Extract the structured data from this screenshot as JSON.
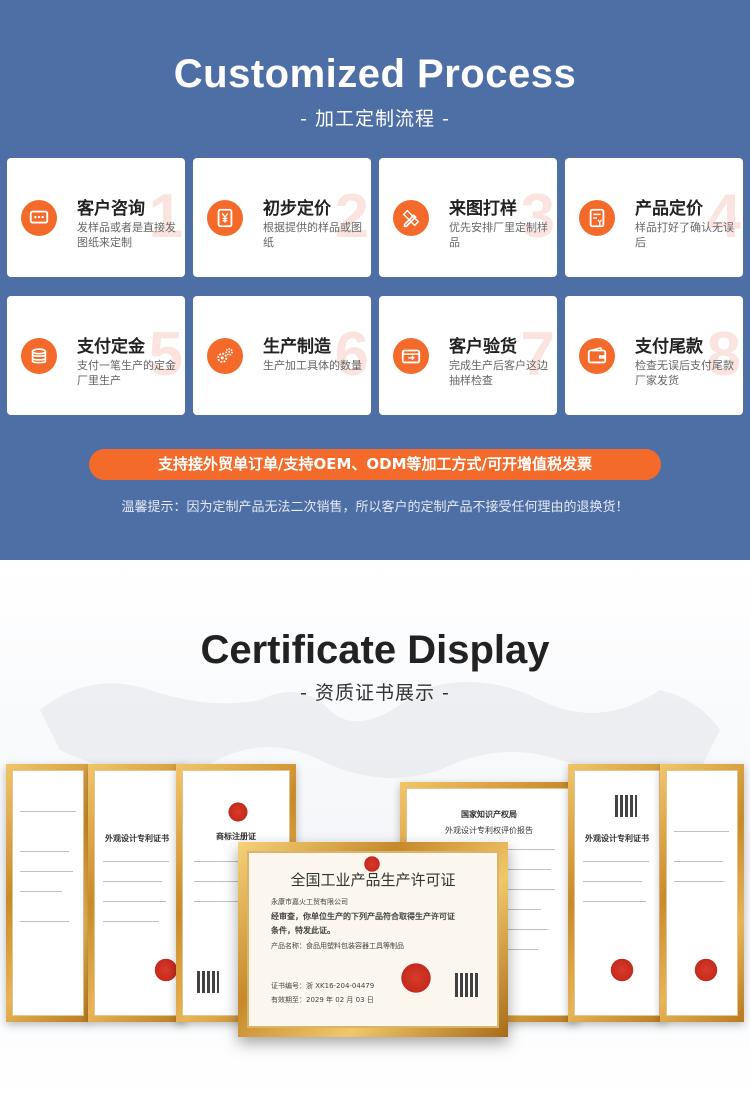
{
  "process": {
    "title": "Customized Process",
    "subtitle": "- 加工定制流程 -",
    "cards": [
      {
        "num": "1",
        "icon": "chat-bubble-icon",
        "title": "客户咨询",
        "desc": "发样品或者是直接发图纸来定制"
      },
      {
        "num": "2",
        "icon": "yuan-price-icon",
        "title": "初步定价",
        "desc": "根据提供的样品或图纸"
      },
      {
        "num": "3",
        "icon": "pencil-ruler-icon",
        "title": "来图打样",
        "desc": "优先安排厂里定制样品"
      },
      {
        "num": "4",
        "icon": "price-list-icon",
        "title": "产品定价",
        "desc": "样品打好了确认无误后"
      },
      {
        "num": "5",
        "icon": "coin-stack-icon",
        "title": "支付定金",
        "desc": "支付一笔生产的定金厂里生产"
      },
      {
        "num": "6",
        "icon": "gears-icon",
        "title": "生产制造",
        "desc": "生产加工具体的数量"
      },
      {
        "num": "7",
        "icon": "delivery-box-icon",
        "title": "客户验货",
        "desc": "完成生产后客户这边抽样检查"
      },
      {
        "num": "8",
        "icon": "wallet-icon",
        "title": "支付尾款",
        "desc": "检查无误后支付尾款厂家发货"
      }
    ],
    "banner": "支持接外贸单订单/支持OEM、ODM等加工方式/可开增值税发票",
    "tip": "温馨提示：因为定制产品无法二次销售，所以客户的定制产品不接受任何理由的退换货！"
  },
  "certificates": {
    "title": "Certificate Display",
    "subtitle": "- 资质证书展示 -",
    "main_cert_title": "全国工业产品生产许可证",
    "main_cert_company": "永康市嘉火工贸有限公司",
    "main_cert_line1": "经审查，你单位生产的下列产品符合取得生产许可证",
    "main_cert_line2": "条件，特发此证。",
    "main_cert_product": "产品名称：食品用塑料包装容器工具等制品",
    "main_cert_number": "证书编号：浙 XK16-204-04479",
    "main_cert_valid": "有效期至：2029 年 02 月 03 日",
    "left_cert_header": "外观设计专利证书",
    "trademark_header": "商标注册证",
    "right_cert_header": "外观设计专利证书",
    "report_header": "国家知识产权局",
    "report_sub": "外观设计专利权评价报告",
    "colors": {
      "blue_bg": "#4e6fa6",
      "accent": "#f36a2a"
    }
  }
}
